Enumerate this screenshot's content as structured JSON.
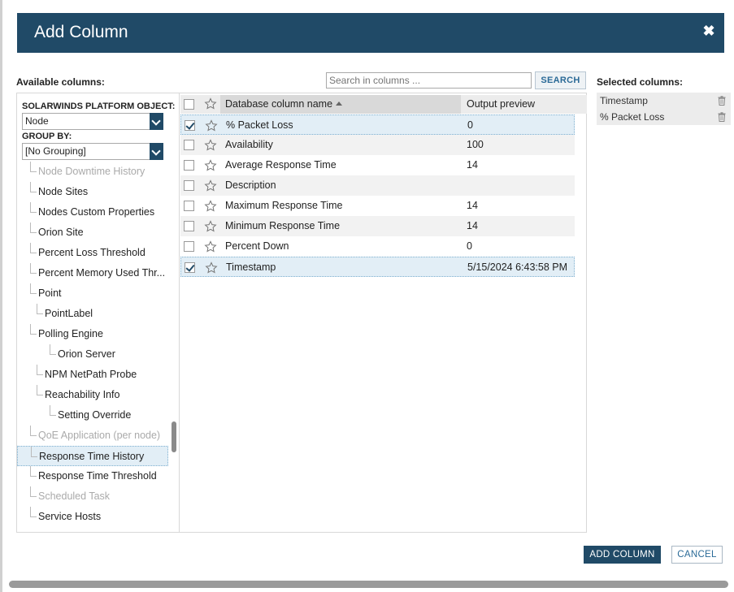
{
  "dialog": {
    "title": "Add Column",
    "close_symbol": "✖"
  },
  "available": {
    "label": "Available columns:",
    "search_placeholder": "Search in columns ...",
    "search_button": "SEARCH",
    "object_label": "SOLARWINDS PLATFORM OBJECT:",
    "object_value": "Node",
    "group_label": "GROUP BY:",
    "group_value": "[No Grouping]"
  },
  "tree": [
    {
      "label": "Node Downtime History",
      "disabled": true,
      "level": 1
    },
    {
      "label": "Node Sites",
      "disabled": false,
      "level": 1
    },
    {
      "label": "Nodes Custom Properties",
      "disabled": false,
      "level": 1
    },
    {
      "label": "Orion Site",
      "disabled": false,
      "level": 1
    },
    {
      "label": "Percent Loss Threshold",
      "disabled": false,
      "level": 1
    },
    {
      "label": "Percent Memory Used Thr...",
      "disabled": false,
      "level": 1
    },
    {
      "label": "Point",
      "disabled": false,
      "level": 1
    },
    {
      "label": "PointLabel",
      "disabled": false,
      "level": 2
    },
    {
      "label": "Polling Engine",
      "disabled": false,
      "level": 1
    },
    {
      "label": "Orion Server",
      "disabled": false,
      "level": 3
    },
    {
      "label": "NPM NetPath Probe",
      "disabled": false,
      "level": 2
    },
    {
      "label": "Reachability Info",
      "disabled": false,
      "level": 2
    },
    {
      "label": "Setting Override",
      "disabled": false,
      "level": 3
    },
    {
      "label": "QoE Application (per node)",
      "disabled": true,
      "level": 1
    },
    {
      "label": "Response Time History",
      "disabled": false,
      "level": 1,
      "selected": true
    },
    {
      "label": "Response Time Threshold",
      "disabled": false,
      "level": 1
    },
    {
      "label": "Scheduled Task",
      "disabled": true,
      "level": 1
    },
    {
      "label": "Service Hosts",
      "disabled": false,
      "level": 1
    }
  ],
  "grid": {
    "col_name": "Database column name",
    "col_preview": "Output preview",
    "rows": [
      {
        "name": "% Packet Loss",
        "preview": "0",
        "checked": true
      },
      {
        "name": "Availability",
        "preview": "100",
        "checked": false
      },
      {
        "name": "Average Response Time",
        "preview": "14",
        "checked": false
      },
      {
        "name": "Description",
        "preview": "",
        "checked": false
      },
      {
        "name": "Maximum Response Time",
        "preview": "14",
        "checked": false
      },
      {
        "name": "Minimum Response Time",
        "preview": "14",
        "checked": false
      },
      {
        "name": "Percent Down",
        "preview": "0",
        "checked": false
      },
      {
        "name": "Timestamp",
        "preview": "5/15/2024 6:43:58 PM",
        "checked": true
      }
    ]
  },
  "selected": {
    "label": "Selected columns:",
    "items": [
      "Timestamp",
      "% Packet Loss"
    ]
  },
  "footer": {
    "add_button": "ADD COLUMN",
    "cancel_button": "CANCEL"
  },
  "colors": {
    "header": "#204a67",
    "selection": "#e2eef6",
    "link": "#2a6a97"
  }
}
